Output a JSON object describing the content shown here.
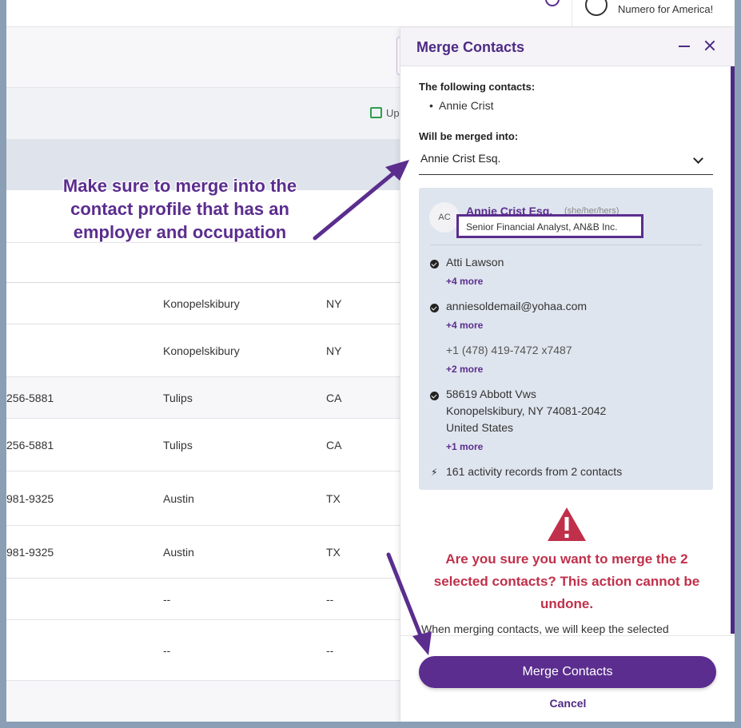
{
  "topbar": {
    "org_name": "Numero for America!"
  },
  "background": {
    "update_label": "Up"
  },
  "table": {
    "rows": [
      {
        "phone": "",
        "city": "Konopelskibury",
        "state": "NY",
        "height": 52,
        "alt": false
      },
      {
        "phone": "",
        "city": "Konopelskibury",
        "state": "NY",
        "height": 66,
        "alt": false
      },
      {
        "phone": "256-5881",
        "city": "Tulips",
        "state": "CA",
        "height": 52,
        "alt": true
      },
      {
        "phone": "256-5881",
        "city": "Tulips",
        "state": "CA",
        "height": 66,
        "alt": false
      },
      {
        "phone": "981-9325",
        "city": "Austin",
        "state": "TX",
        "height": 68,
        "alt": false
      },
      {
        "phone": "981-9325",
        "city": "Austin",
        "state": "TX",
        "height": 66,
        "alt": false
      },
      {
        "phone": "",
        "city": "--",
        "state": "--",
        "height": 52,
        "alt": false
      },
      {
        "phone": "",
        "city": "--",
        "state": "--",
        "height": 76,
        "alt": false
      }
    ]
  },
  "panel": {
    "title": "Merge Contacts",
    "following_label": "The following contacts:",
    "following_contacts": [
      "Annie Crist"
    ],
    "merged_into_label": "Will be merged into:",
    "merged_into_value": "Annie Crist Esq.",
    "card": {
      "initials": "AC",
      "name": "Annie Crist Esq.",
      "pronouns": "(she/her/hers)",
      "occupation": "Senior Financial Analyst, AN&B Inc.",
      "contact_name": "Atti Lawson",
      "contact_name_more": "+4 more",
      "email": "anniesoldemail@yohaa.com",
      "email_more": "+4 more",
      "phone": "+1 (478) 419-7472 x7487",
      "phone_more": "+2 more",
      "address_line1": "58619 Abbott Vws",
      "address_line2": "Konopelskibury, NY 74081-2042",
      "address_line3": "United States",
      "address_more": "+1 more",
      "activity": "161 activity records from 2 contacts"
    },
    "warning": "Are you sure you want to merge the 2 selected contacts? This action cannot be undone.",
    "info": "When merging contacts, we will keep the selected",
    "merge_button": "Merge Contacts",
    "cancel_button": "Cancel"
  },
  "annotation": {
    "text": "Make sure to merge into the contact profile that has an employer and occupation",
    "color": "#5b2d8e"
  },
  "colors": {
    "brand": "#5b2d8e",
    "warning": "#c0304a",
    "card_bg": "#dfe5ee"
  }
}
